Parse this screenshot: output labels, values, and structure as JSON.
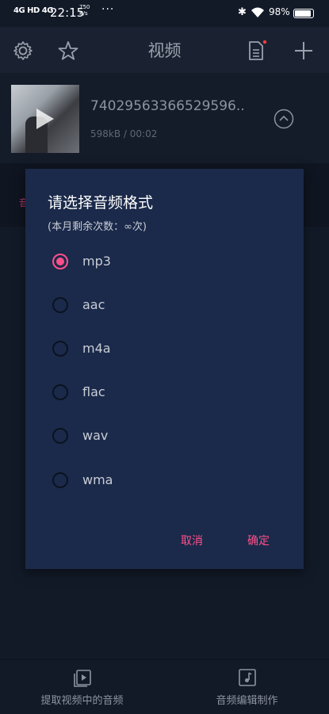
{
  "status_bar": {
    "signal": "4G HD 4G",
    "time": "22:15",
    "speed_value": "750",
    "speed_unit": "K/s",
    "more": "···",
    "battery": "98%",
    "battery_level": 0.98
  },
  "toolbar": {
    "title": "视频",
    "icons": [
      "gear-icon",
      "star-icon",
      "document-icon",
      "plus-icon"
    ]
  },
  "video": {
    "name": "74029563366529596..",
    "meta": "598kB / 00:02"
  },
  "background_tab_char": "音",
  "dialog": {
    "title": "请选择音频格式",
    "subtitle": "(本月剩余次数：∞次)",
    "options": [
      {
        "label": "mp3",
        "selected": true
      },
      {
        "label": "aac",
        "selected": false
      },
      {
        "label": "m4a",
        "selected": false
      },
      {
        "label": "flac",
        "selected": false
      },
      {
        "label": "wav",
        "selected": false
      },
      {
        "label": "wma",
        "selected": false
      }
    ],
    "cancel": "取消",
    "confirm": "确定",
    "accent": "#ff4f8b"
  },
  "bottom_nav": [
    {
      "label": "提取视频中的音频",
      "icon": "video-extract-icon"
    },
    {
      "label": "音频编辑制作",
      "icon": "music-note-icon"
    }
  ]
}
